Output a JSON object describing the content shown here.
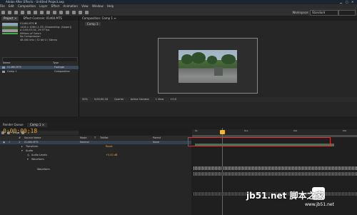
{
  "window": {
    "title": "Adobe After Effects - Untitled Project.aep",
    "controls": [
      "minimize-icon",
      "maximize-icon",
      "close-icon"
    ]
  },
  "menu": [
    "File",
    "Edit",
    "Composition",
    "Layer",
    "Effect",
    "Animation",
    "View",
    "Window",
    "Help"
  ],
  "toolbar": {
    "workspace_label": "Workspace:",
    "workspace_value": "Standard",
    "search_placeholder": "Search Help"
  },
  "project_panel": {
    "tabs": [
      "Project ×",
      "Effect Controls: 01460.MTS"
    ],
    "footage_name": "01460.MTS ▼",
    "info_lines": [
      "1440 x 1080 (1.33) (Separating: (Upper))",
      "Δ 0;00;03;18, 29.97 fps",
      "Millions of Colors",
      "No Compression",
      "48.000 kHz / 32 bit U / Stereo"
    ],
    "column_name": "Name",
    "column_type": "Type",
    "items": [
      {
        "name": "01460.MTS",
        "type": "Footage"
      },
      {
        "name": "Comp 1",
        "type": "Composition"
      }
    ],
    "bit_depth": "8 bpc"
  },
  "viewer_panel": {
    "tab": "Composition: Comp 1 ≡",
    "comp_label": "Comp 1",
    "controls": [
      "50%",
      "0;00;00;18",
      "Quarter",
      "Active Camera",
      "1 View",
      "+0.0"
    ]
  },
  "timeline": {
    "tabs": [
      "Render Queue",
      "Comp 1 ×"
    ],
    "timecode": "0;00;00;18",
    "columns": [
      "#",
      "Source Name",
      "Mode",
      "T",
      "TrkMat",
      "Parent"
    ],
    "rows": [
      {
        "indent": 0,
        "num": "1",
        "name": "01460.MTS",
        "mode": "Normal",
        "parent": "None"
      },
      {
        "indent": 1,
        "num": "",
        "name": "Transform",
        "mode": "",
        "parent": "Reset"
      },
      {
        "indent": 1,
        "num": "",
        "name": "Audio",
        "mode": "",
        "parent": ""
      },
      {
        "indent": 2,
        "num": "",
        "name": "Audio Levels",
        "mode": "",
        "parent": "+0.00 dB"
      },
      {
        "indent": 2,
        "num": "",
        "name": "Waveform",
        "mode": "",
        "parent": ""
      },
      {
        "indent": 3,
        "num": "",
        "name": "Waveform",
        "mode": "",
        "parent": ""
      }
    ],
    "ruler_labels": [
      "0s",
      "01s",
      "02s",
      "03s"
    ],
    "playhead_fraction": 0.18
  },
  "watermark": {
    "main": "脚本之家",
    "site": "jb51.net",
    "sub": "www.jb51.net"
  },
  "colors": {
    "timecode": "#e8a735",
    "playhead": "#e03030",
    "highlight": "#e03030",
    "layer_bar": "#4f6e52"
  }
}
